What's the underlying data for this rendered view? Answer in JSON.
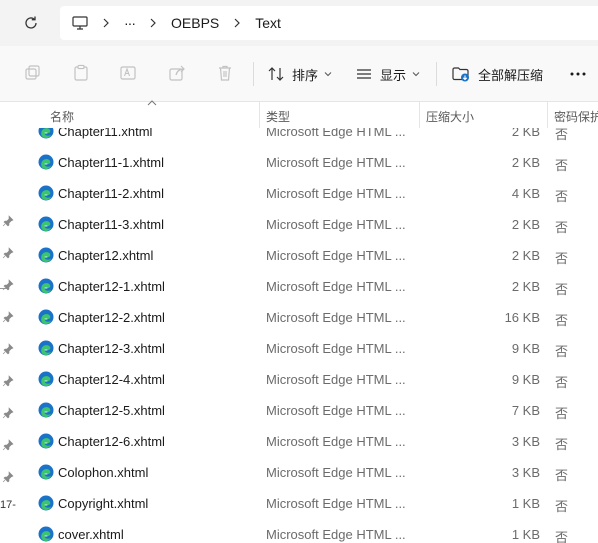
{
  "address": {
    "refresh_icon": "refresh-icon",
    "computer_icon": "computer-icon",
    "overflow": "···",
    "path": [
      "OEBPS",
      "Text"
    ]
  },
  "toolbar": {
    "icons": [
      "new-icon",
      "paste-icon",
      "rename-icon",
      "share-icon",
      "delete-icon"
    ],
    "sort_label": "排序",
    "view_label": "显示",
    "extract_label": "全部解压缩",
    "more_label": "···"
  },
  "left_strip": {
    "label": "17-"
  },
  "columns": {
    "name": "名称",
    "type": "类型",
    "size": "压缩大小",
    "protected": "密码保护"
  },
  "colors": {
    "edge_blue": "#1a73c8",
    "edge_green": "#3cc46e",
    "text_secondary": "#6b6b6b"
  },
  "files": [
    {
      "name": "Chapter11.xhtml",
      "type": "Microsoft Edge HTML ...",
      "size": "2 KB",
      "protected": "否"
    },
    {
      "name": "Chapter11-1.xhtml",
      "type": "Microsoft Edge HTML ...",
      "size": "2 KB",
      "protected": "否"
    },
    {
      "name": "Chapter11-2.xhtml",
      "type": "Microsoft Edge HTML ...",
      "size": "4 KB",
      "protected": "否"
    },
    {
      "name": "Chapter11-3.xhtml",
      "type": "Microsoft Edge HTML ...",
      "size": "2 KB",
      "protected": "否"
    },
    {
      "name": "Chapter12.xhtml",
      "type": "Microsoft Edge HTML ...",
      "size": "2 KB",
      "protected": "否"
    },
    {
      "name": "Chapter12-1.xhtml",
      "type": "Microsoft Edge HTML ...",
      "size": "2 KB",
      "protected": "否"
    },
    {
      "name": "Chapter12-2.xhtml",
      "type": "Microsoft Edge HTML ...",
      "size": "16 KB",
      "protected": "否"
    },
    {
      "name": "Chapter12-3.xhtml",
      "type": "Microsoft Edge HTML ...",
      "size": "9 KB",
      "protected": "否"
    },
    {
      "name": "Chapter12-4.xhtml",
      "type": "Microsoft Edge HTML ...",
      "size": "9 KB",
      "protected": "否"
    },
    {
      "name": "Chapter12-5.xhtml",
      "type": "Microsoft Edge HTML ...",
      "size": "7 KB",
      "protected": "否"
    },
    {
      "name": "Chapter12-6.xhtml",
      "type": "Microsoft Edge HTML ...",
      "size": "3 KB",
      "protected": "否"
    },
    {
      "name": "Colophon.xhtml",
      "type": "Microsoft Edge HTML ...",
      "size": "3 KB",
      "protected": "否"
    },
    {
      "name": "Copyright.xhtml",
      "type": "Microsoft Edge HTML ...",
      "size": "1 KB",
      "protected": "否"
    },
    {
      "name": "cover.xhtml",
      "type": "Microsoft Edge HTML ...",
      "size": "1 KB",
      "protected": "否"
    }
  ]
}
